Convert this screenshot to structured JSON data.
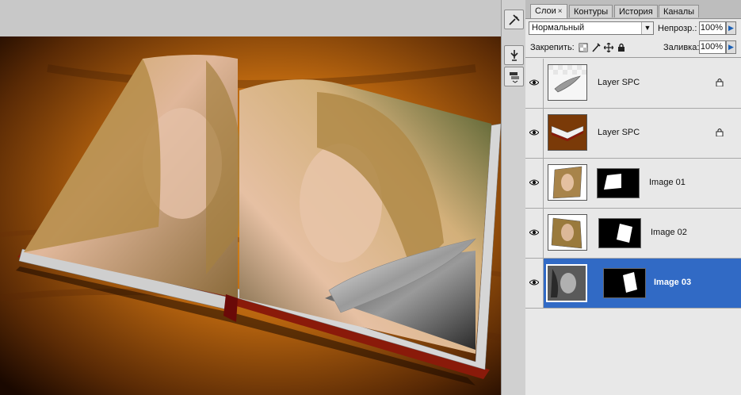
{
  "layers_panel": {
    "tabs": [
      {
        "label": "Слои",
        "active": true
      },
      {
        "label": "Контуры",
        "active": false
      },
      {
        "label": "История",
        "active": false
      },
      {
        "label": "Каналы",
        "active": false
      }
    ],
    "close_glyph": "×",
    "blend_mode": "Нормальный",
    "opacity_label": "Непрозр.:",
    "opacity_value": "100%",
    "lock_label": "Закрепить:",
    "fill_label": "Заливка:",
    "fill_value": "100%",
    "layers": [
      {
        "name": "Layer SPC",
        "visible": true,
        "locked": true,
        "selected": false,
        "thumb": "paper-curl"
      },
      {
        "name": "Layer SPC",
        "visible": true,
        "locked": true,
        "selected": false,
        "thumb": "book"
      },
      {
        "name": "Image 01",
        "visible": true,
        "locked": false,
        "selected": false,
        "thumb": "photo-color",
        "has_mask": true
      },
      {
        "name": "Image 02",
        "visible": true,
        "locked": false,
        "selected": false,
        "thumb": "photo-color",
        "has_mask": true
      },
      {
        "name": "Image 03",
        "visible": true,
        "locked": false,
        "selected": true,
        "thumb": "photo-gray",
        "has_mask": true
      }
    ]
  },
  "colors": {
    "selection": "#316ac5",
    "panel_bg": "#e8e8e8",
    "canvas_wood": "#8a4a0c"
  },
  "icons": {
    "tool_1": "brush-tools-icon",
    "tool_2": "usb-brush-icon",
    "tool_3": "layer-comps-icon",
    "eye": "eye-icon",
    "lock": "lock-icon"
  }
}
